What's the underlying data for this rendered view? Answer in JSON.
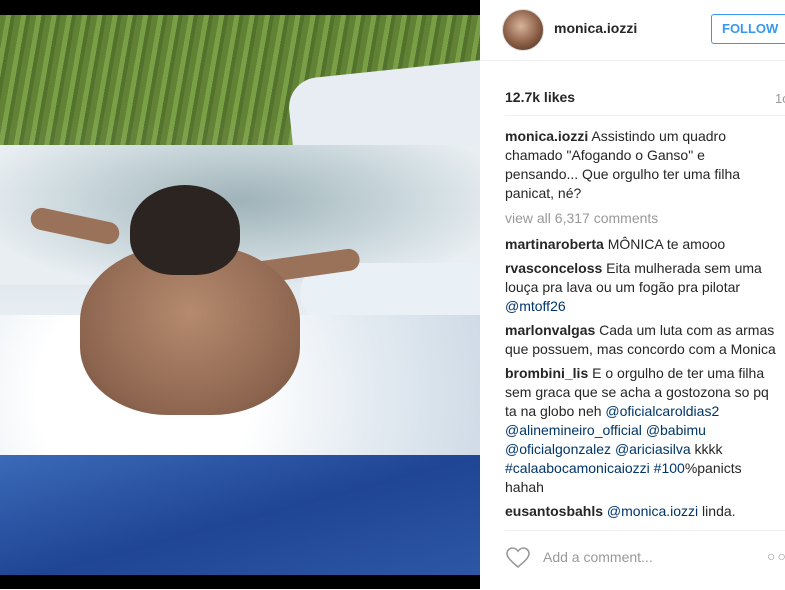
{
  "photo": {
    "description_icon": "photo-image"
  },
  "header": {
    "username": "monica.iozzi",
    "follow_label": "FOLLOW"
  },
  "stats": {
    "likes": "12.7k likes",
    "time_ago": "1c"
  },
  "caption": {
    "author": "monica.iozzi",
    "text": " Assistindo um quadro chamado \"Afogando o Ganso\" e pensando... Que orgulho ter uma filha panicat, né?"
  },
  "view_all": "view all 6,317 comments",
  "comments": [
    {
      "author": "martinaroberta",
      "text": " MÔNICA te amooo"
    },
    {
      "author": "rvasconceloss",
      "text": " Eita mulherada sem uma louça pra lava ou um fogão pra pilotar ",
      "mention": "@mtoff26"
    },
    {
      "author": "marlonvalgas",
      "text": " Cada um luta com as armas que possuem, mas concordo com a Monica"
    },
    {
      "author": "brombini_lis",
      "text": " E o orgulho de ter uma filha sem graca que se acha a gostozona so pq ta na globo neh ",
      "mentions": [
        "@oficialcaroldias2",
        "@alinemineiro_official",
        "@babimu",
        "@oficialgonzalez",
        "@ariciasilva"
      ],
      "tail": " kkkk ",
      "hashtags": [
        "#calaabocamonicaiozzi",
        "#100"
      ],
      "end": "%panicts hahah"
    },
    {
      "author": "eusantosbahls",
      "text": " linda.",
      "mention": "@monica.iozzi"
    }
  ],
  "footer": {
    "add_comment_placeholder": "Add a comment...",
    "more_label": "○○"
  }
}
